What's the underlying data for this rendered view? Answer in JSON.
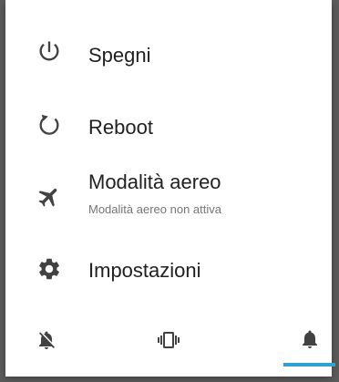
{
  "power_menu": {
    "items": [
      {
        "label": "Spegni",
        "icon": "power-icon"
      },
      {
        "label": "Reboot",
        "icon": "restart-icon"
      },
      {
        "label": "Modalità aereo",
        "sublabel": "Modalità aereo non attiva",
        "icon": "airplane-icon"
      },
      {
        "label": "Impostazioni",
        "icon": "settings-gear-icon"
      }
    ]
  },
  "sound_modes": {
    "options": [
      {
        "name": "silent",
        "icon": "bell-off-icon",
        "selected": false
      },
      {
        "name": "vibrate",
        "icon": "vibrate-icon",
        "selected": false
      },
      {
        "name": "sound",
        "icon": "bell-icon",
        "selected": true
      }
    ]
  },
  "colors": {
    "icon": "#424242",
    "text_primary": "#212121",
    "text_secondary": "#757575",
    "accent": "#29a6d9",
    "background_dim": "#5c5c5c"
  }
}
